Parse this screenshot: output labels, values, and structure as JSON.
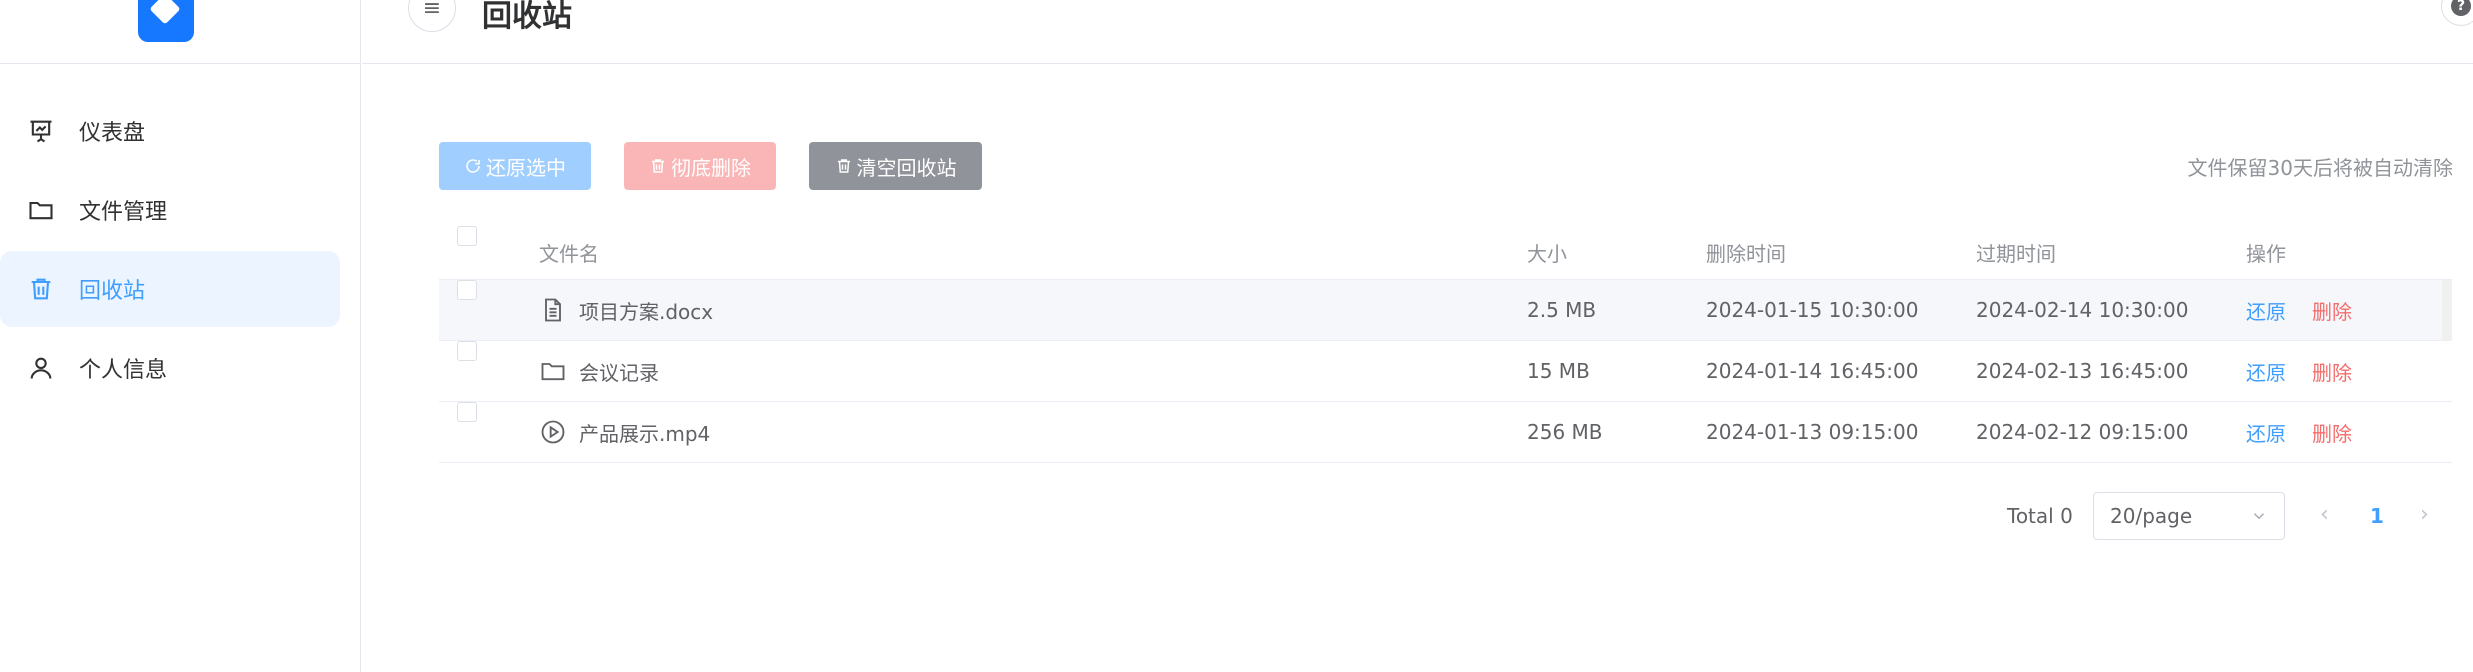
{
  "sidebar": {
    "items": [
      {
        "label": "仪表盘",
        "icon": "dashboard-icon"
      },
      {
        "label": "文件管理",
        "icon": "folder-icon"
      },
      {
        "label": "回收站",
        "icon": "trash-icon",
        "active": true
      },
      {
        "label": "个人信息",
        "icon": "user-icon"
      }
    ]
  },
  "header": {
    "title": "回收站",
    "menu_icon": "≡",
    "help_icon": "?"
  },
  "toolbar": {
    "restore_label": "还原选中",
    "delete_label": "彻底删除",
    "empty_label": "清空回收站",
    "notice": "文件保留30天后将被自动清除"
  },
  "table": {
    "columns": {
      "name": "文件名",
      "size": "大小",
      "deleted": "删除时间",
      "expires": "过期时间",
      "actions": "操作"
    },
    "rows": [
      {
        "name": "项目方案.docx",
        "icon": "document-icon",
        "size": "2.5 MB",
        "deleted": "2024-01-15 10:30:00",
        "expires": "2024-02-14 10:30:00",
        "restore": "还原",
        "delete": "删除"
      },
      {
        "name": "会议记录",
        "icon": "folder-icon",
        "size": "15 MB",
        "deleted": "2024-01-14 16:45:00",
        "expires": "2024-02-13 16:45:00",
        "restore": "还原",
        "delete": "删除"
      },
      {
        "name": "产品展示.mp4",
        "icon": "video-icon",
        "size": "256 MB",
        "deleted": "2024-01-13 09:15:00",
        "expires": "2024-02-12 09:15:00",
        "restore": "还原",
        "delete": "删除"
      }
    ]
  },
  "pagination": {
    "total": "Total 0",
    "page_size": "20/page",
    "current_page": "1"
  },
  "colors": {
    "primary": "#409eff",
    "danger": "#f56c6c",
    "active_bg": "#ecf5ff"
  }
}
